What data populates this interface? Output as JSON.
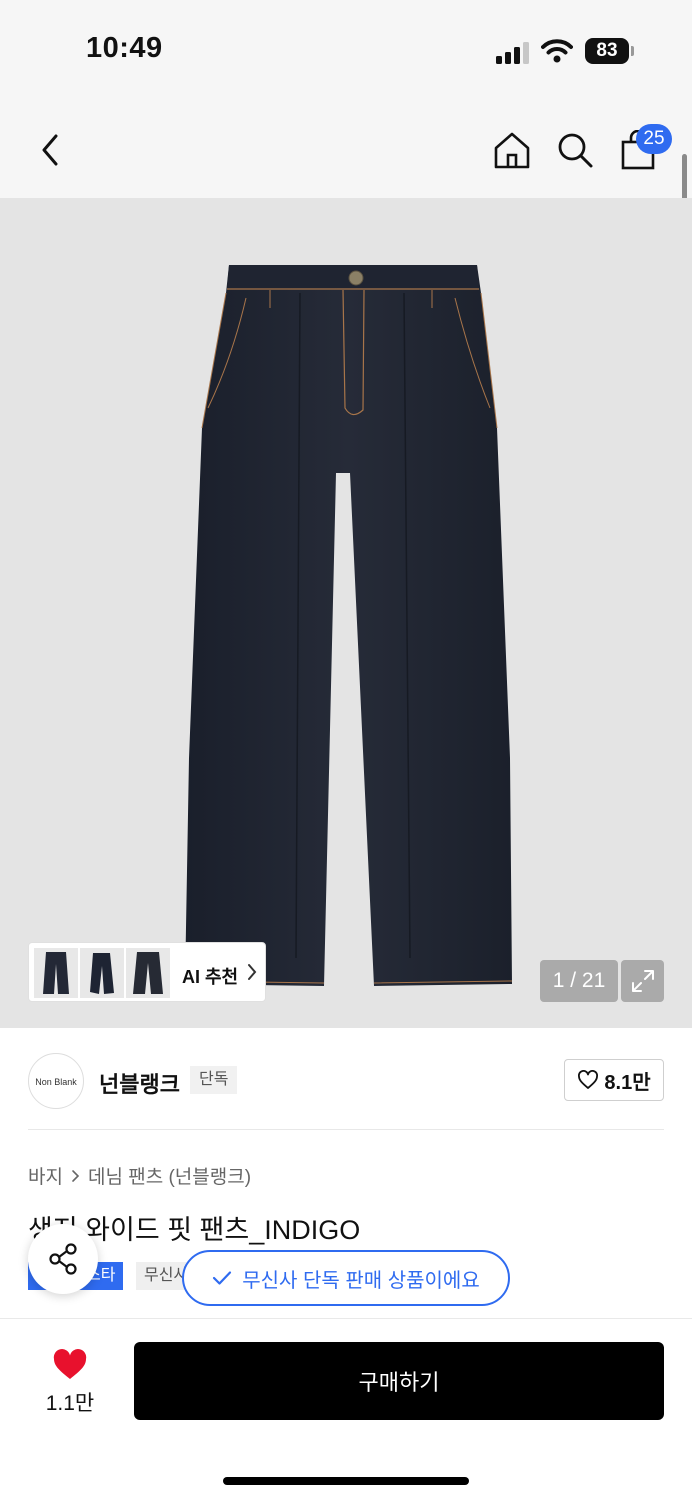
{
  "status_bar": {
    "time": "10:49",
    "battery": "83"
  },
  "nav": {
    "cart_count": "25",
    "icons": [
      "back-icon",
      "home-icon",
      "search-icon",
      "shopping-bag-icon"
    ]
  },
  "gallery": {
    "counter": "1 / 21",
    "ai_label": "AI 추천"
  },
  "brand": {
    "logo_text": "Non Blank",
    "name": "넌블랭크",
    "tag": "단독",
    "likes": "8.1만"
  },
  "product": {
    "breadcrumb": [
      "바지",
      "데님 팬츠 (넌블랭크)"
    ],
    "title": "생지 와이드 핏 팬츠_INDIGO",
    "tags": [
      "스타",
      "무신사"
    ],
    "exclusive_notice": "무신사 단독 판매 상품이에요"
  },
  "bottom": {
    "wish_count": "1.1만",
    "buy_label": "구매하기"
  },
  "colors": {
    "accent": "#2f6bf0",
    "wish_heart": "#e8112d",
    "buy_button": "#000000",
    "image_bg": "#e4e4e4"
  }
}
